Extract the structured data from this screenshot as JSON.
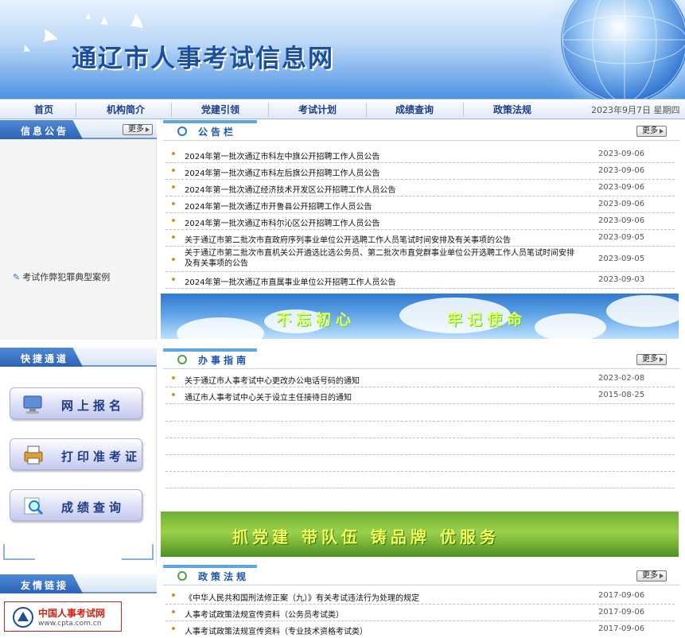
{
  "site": {
    "title": "通辽市人事考试信息网"
  },
  "nav": {
    "items": [
      "首页",
      "机构简介",
      "党建引领",
      "考试计划",
      "成绩查询",
      "政策法规"
    ],
    "date": "2023年9月7日  星期四"
  },
  "left": {
    "notice_title": "信息公告",
    "more": "更多",
    "notice_link": "考试作弊犯罪典型案例",
    "quick_title": "快捷通道",
    "quick_buttons": [
      "网上报名",
      "打印准考证",
      "成绩查询"
    ],
    "links_title": "友情链接",
    "cpta": {
      "name": "中国人事考试网",
      "url": "www.cpta.com.cn"
    }
  },
  "bulletin": {
    "title": "公告栏",
    "more": "更多",
    "items": [
      {
        "title": "2024年第一批次通辽市科左中旗公开招聘工作人员公告",
        "date": "2023-09-06"
      },
      {
        "title": "2024年第一批次通辽市科左后旗公开招聘工作人员公告",
        "date": "2023-09-06"
      },
      {
        "title": "2024年第一批次通辽经济技术开发区公开招聘工作人员公告",
        "date": "2023-09-06"
      },
      {
        "title": "2024年第一批次通辽市开鲁县公开招聘工作人员公告",
        "date": "2023-09-06"
      },
      {
        "title": "2024年第一批次通辽市科尔沁区公开招聘工作人员公告",
        "date": "2023-09-06"
      },
      {
        "title": "关于通辽市第二批次市直政府序列事业单位公开选聘工作人员笔试时间安排及有关事项的公告",
        "date": "2023-09-05"
      },
      {
        "title": "关于通辽市第二批次市直机关公开遴选比选公务员、第二批次市直党群事业单位公开选聘工作人员笔试时间安排及有关事项的公告",
        "date": "2023-09-05"
      },
      {
        "title": "2024年第一批次通辽市直属事业单位公开招聘工作人员公告",
        "date": "2023-09-03"
      }
    ]
  },
  "banner1": {
    "left": "不忘初心",
    "right": "牢记使命"
  },
  "guide": {
    "title": "办事指南",
    "more": "更多",
    "items": [
      {
        "title": "关于通辽市人事考试中心更改办公电话号码的通知",
        "date": "2023-02-08"
      },
      {
        "title": "通辽市人事考试中心关于设立主任接待日的通知",
        "date": "2015-08-25"
      }
    ]
  },
  "banner2": {
    "text": "抓党建 带队伍 铸品牌 优服务"
  },
  "policy": {
    "title": "政策法规",
    "more": "更多",
    "items": [
      {
        "title": "《中华人民共和国刑法修正案（九）》有关考试违法行为处理的规定",
        "date": "2017-09-06"
      },
      {
        "title": "人事考试政策法规宣传资料（公务员考试类）",
        "date": "2017-09-06"
      },
      {
        "title": "人事考试政策法规宣传资料（专业技术资格考试类）",
        "date": "2017-09-06"
      }
    ]
  }
}
